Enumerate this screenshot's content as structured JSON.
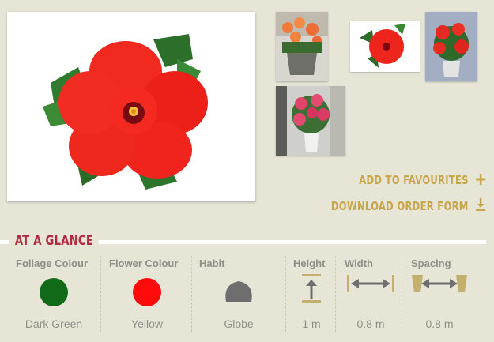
{
  "actions": {
    "favourites_label": "ADD TO FAVOURITES",
    "favourites_icon": "plus-icon",
    "download_label": "DOWNLOAD ORDER FORM",
    "download_icon": "download-icon"
  },
  "glance": {
    "title": "AT A GLANCE",
    "columns": [
      {
        "heading": "Foliage Colour",
        "value": "Dark Green",
        "color": "#116a17"
      },
      {
        "heading": "Flower Colour",
        "value": "Yellow",
        "color": "#ff0b0b"
      },
      {
        "heading": "Habit",
        "value": "Globe",
        "color": "#6e6e6e",
        "icon": "globe-habit-icon"
      },
      {
        "heading": "Height",
        "value": "1 m",
        "icon": "height-icon"
      },
      {
        "heading": "Width",
        "value": "0.8 m",
        "icon": "width-icon"
      },
      {
        "heading": "Spacing",
        "value": "0.8 m",
        "icon": "spacing-icon"
      }
    ]
  },
  "colors": {
    "background": "#e6e5d6",
    "accent_gold": "#c9a54a",
    "accent_red": "#b3293f",
    "label_grey": "#8f8f88"
  }
}
